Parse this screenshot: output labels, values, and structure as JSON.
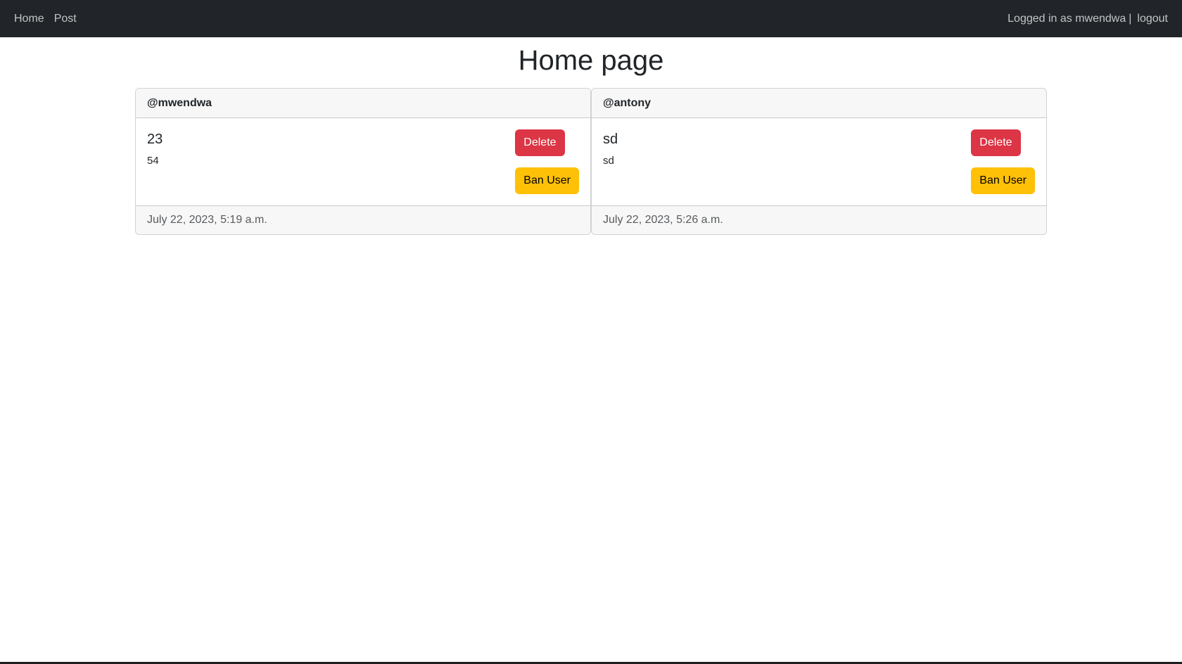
{
  "nav": {
    "home_label": "Home",
    "post_label": "Post",
    "logged_in_text": "Logged in as mwendwa",
    "separator": "|",
    "logout_label": "logout"
  },
  "page": {
    "title": "Home page"
  },
  "posts": [
    {
      "author": "@mwendwa",
      "title": "23",
      "content": "54",
      "delete_label": "Delete",
      "ban_label": "Ban User",
      "timestamp": "July 22, 2023, 5:19 a.m."
    },
    {
      "author": "@antony",
      "title": "sd",
      "content": "sd",
      "delete_label": "Delete",
      "ban_label": "Ban User",
      "timestamp": "July 22, 2023, 5:26 a.m."
    }
  ],
  "colors": {
    "navbar_bg": "#212529",
    "danger": "#dc3545",
    "warning": "#ffc107",
    "card_cap_bg": "#f7f7f7"
  }
}
